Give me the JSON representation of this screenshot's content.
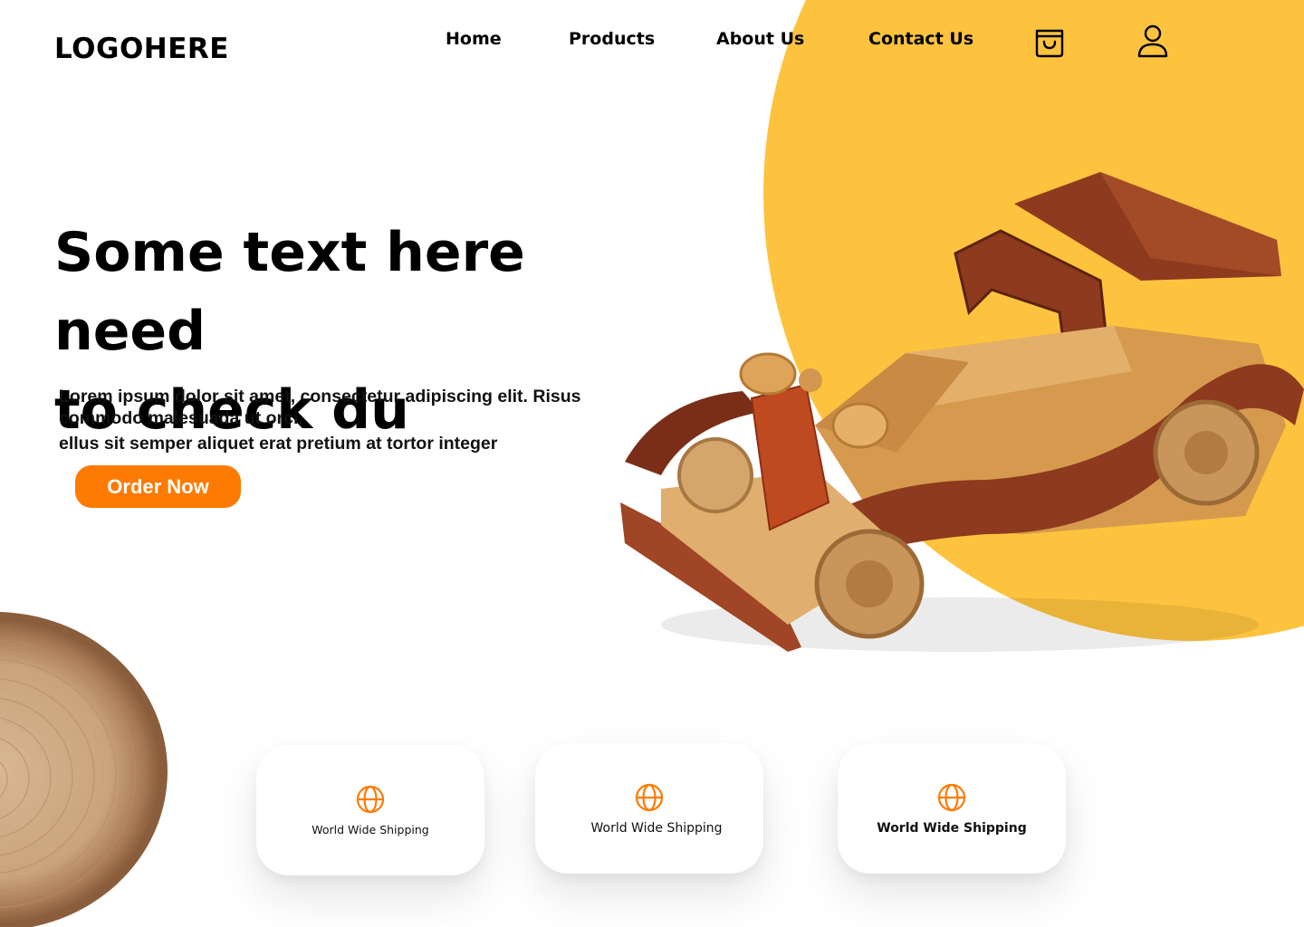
{
  "logo": "LOGOHERE",
  "nav": {
    "items": [
      "Home",
      "Products",
      "About Us",
      "Contact Us"
    ]
  },
  "icons": {
    "cart": "shopping-bag-icon",
    "user": "user-icon",
    "feature": "globe-icon"
  },
  "hero": {
    "title_line1": "Some text here need",
    "title_line2": "to check du",
    "paragraph1": "Lorem ipsum dolor sit amet, consectetur adipiscing elit. Risus commodo malesuada ut orci.",
    "paragraph2": "ellus sit semper aliquet erat pretium at tortor integer",
    "cta_label": "Order Now"
  },
  "features": [
    {
      "label": "World Wide Shipping"
    },
    {
      "label": "World Wide Shipping"
    },
    {
      "label": "World Wide Shipping"
    }
  ],
  "colors": {
    "accent": "#FF7A00",
    "background_circle": "#FDC33F",
    "text": "#000000"
  }
}
